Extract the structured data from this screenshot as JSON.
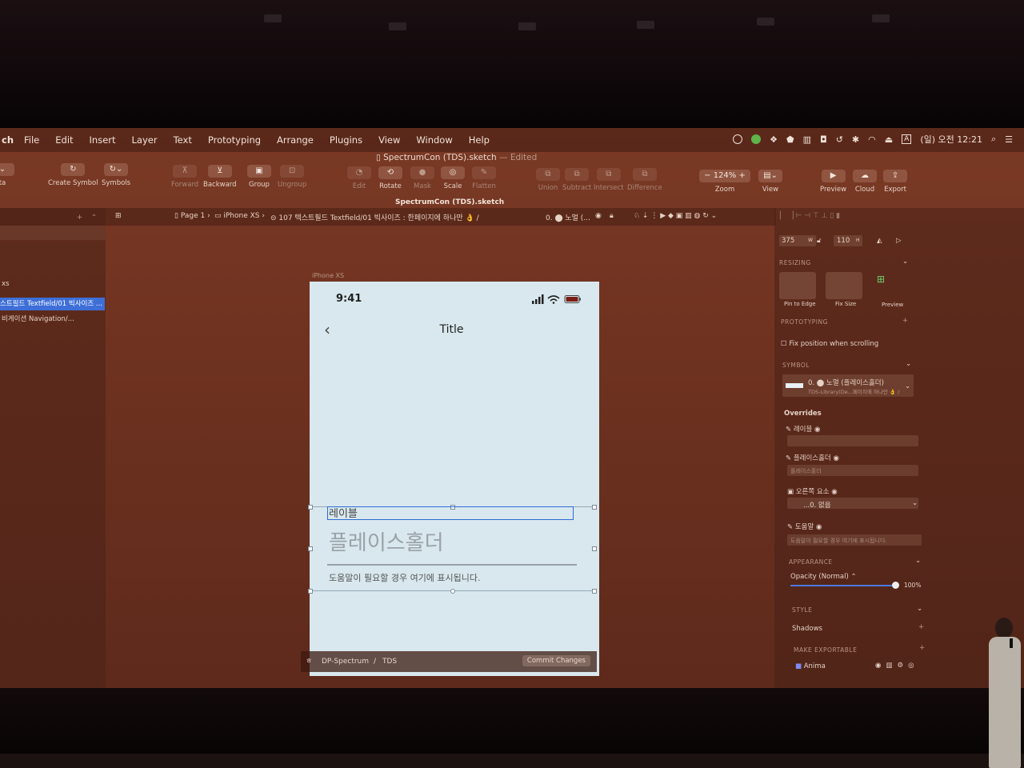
{
  "menubar": {
    "app_fragment": "ch",
    "items": [
      "File",
      "Edit",
      "Insert",
      "Layer",
      "Text",
      "Prototyping",
      "Arrange",
      "Plugins",
      "View",
      "Window",
      "Help"
    ],
    "clock": "(일) 오전 12:21",
    "input_indicator": "A"
  },
  "document": {
    "title": "SpectrumCon (TDS).sketch",
    "edited": "— Edited",
    "file_label": "SpectrumCon (TDS).sketch"
  },
  "toolbar": {
    "create_symbol": "Create Symbol",
    "symbols": "Symbols",
    "forward": "Forward",
    "backward": "Backward",
    "group": "Group",
    "ungroup": "Ungroup",
    "edit": "Edit",
    "rotate": "Rotate",
    "mask": "Mask",
    "scale": "Scale",
    "flatten": "Flatten",
    "union": "Union",
    "subtract": "Subtract",
    "intersect": "Intersect",
    "difference": "Difference",
    "zoom_value": "124%",
    "zoom": "Zoom",
    "view": "View",
    "preview": "Preview",
    "cloud": "Cloud",
    "export": "Export",
    "left_fragment": "ta"
  },
  "breadcrumb": {
    "page": "Page 1",
    "artboard": "iPhone XS",
    "symbol": "107 텍스트필드 Textfield/01 빅사이즈 : 한페이지에 하나만 👌 /",
    "override_preview": "0. ⬤ 노멀 (..."
  },
  "layers": {
    "fragment": "xs",
    "selected": "스트필드 Textfield/01 빅사이즈 ...",
    "other": "비게이션 Navigation/..."
  },
  "artboard": {
    "label": "iPhone XS",
    "time": "9:41",
    "nav_title": "Title",
    "back_glyph": "‹",
    "field_label": "레이블",
    "placeholder": "플레이스홀더",
    "helper": "도움말이 필요할 경우 여기에 표시됩니다."
  },
  "gitbar": {
    "repo": "DP-Spectrum",
    "separator": "/",
    "branch": "TDS",
    "commit": "Commit Changes"
  },
  "inspector": {
    "width": "375",
    "w_label": "W",
    "height": "110",
    "h_label": "H",
    "resizing": "RESIZING",
    "pin_to_edge": "Pin to Edge",
    "fix_size": "Fix Size",
    "preview": "Preview",
    "prototyping": "PROTOTYPING",
    "fix_position": "Fix position when scrolling",
    "symbol": "SYMBOL",
    "symbol_name": "0. ⬤ 노멀 (플레이스홀더)",
    "symbol_path": "TDS-Library(De...페이지에 하나만 👌 /",
    "overrides": "Overrides",
    "ov_label": "레이블",
    "ov_placeholder": "플레이스홀더",
    "ov_placeholder_value": "플레이스홀더",
    "ov_right": "오른쪽 요소",
    "ov_right_value": "...0. 없음",
    "ov_help": "도움말",
    "ov_help_value": "도움말이 필요할 경우 여기에 표시됩니다.",
    "appearance": "APPEARANCE",
    "opacity": "Opacity (Normal)",
    "opacity_value": "100%",
    "style": "STYLE",
    "shadows": "Shadows",
    "make_exportable": "MAKE EXPORTABLE",
    "anima": "Anima"
  },
  "colors": {
    "screen": "#72361f",
    "selection": "#3e6fd8",
    "artboard": "#d8e8ee"
  }
}
